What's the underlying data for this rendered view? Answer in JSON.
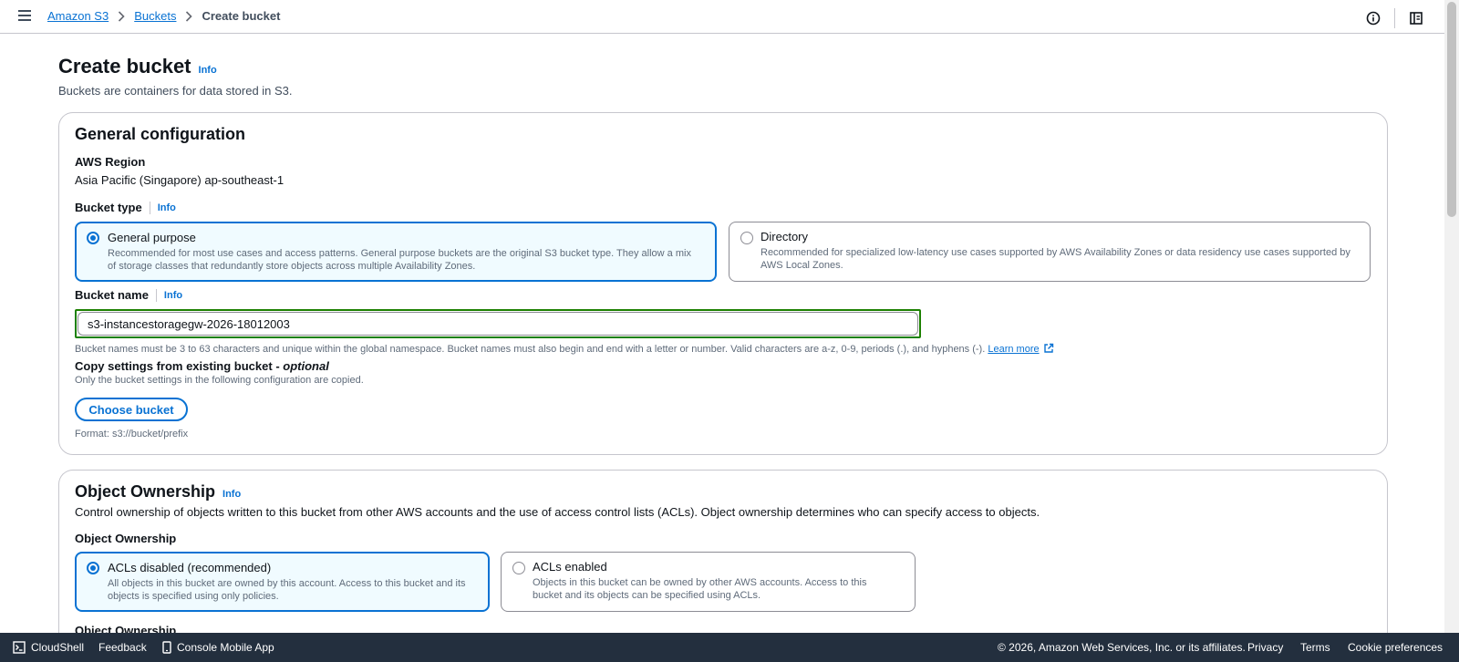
{
  "breadcrumb": {
    "items": [
      "Amazon S3",
      "Buckets"
    ],
    "current": "Create bucket"
  },
  "icons": {
    "menu": "hamburger-menu-icon",
    "info": "info-circle-icon",
    "panel": "notifications-panel-icon",
    "external": "external-link-icon",
    "cloudshell": "terminal-icon",
    "mobile": "mobile-device-icon"
  },
  "page": {
    "title": "Create bucket",
    "info": "Info",
    "description": "Buckets are containers for data stored in S3."
  },
  "general": {
    "heading": "General configuration",
    "region_label": "AWS Region",
    "region_value": "Asia Pacific (Singapore) ap-southeast-1",
    "bucket_type_label": "Bucket type",
    "bucket_type_info": "Info",
    "options": [
      {
        "title": "General purpose",
        "desc": "Recommended for most use cases and access patterns. General purpose buckets are the original S3 bucket type. They allow a mix of storage classes that redundantly store objects across multiple Availability Zones."
      },
      {
        "title": "Directory",
        "desc": "Recommended for specialized low-latency use cases supported by AWS Availability Zones or data residency use cases supported by AWS Local Zones."
      }
    ],
    "bucket_name_label": "Bucket name",
    "bucket_name_info": "Info",
    "bucket_name_value": "s3-instancestoragegw-2026-18012003",
    "bucket_name_hint": "Bucket names must be 3 to 63 characters and unique within the global namespace. Bucket names must also begin and end with a letter or number. Valid characters are a-z, 0-9, periods (.), and hyphens (-).",
    "learn_more": "Learn more",
    "copy_label": "Copy settings from existing bucket -",
    "copy_optional": "optional",
    "copy_desc": "Only the bucket settings in the following configuration are copied.",
    "choose_button": "Choose bucket",
    "format_hint": "Format: s3://bucket/prefix"
  },
  "ownership": {
    "heading": "Object Ownership",
    "info": "Info",
    "description": "Control ownership of objects written to this bucket from other AWS accounts and the use of access control lists (ACLs). Object ownership determines who can specify access to objects.",
    "label": "Object Ownership",
    "options": [
      {
        "title": "ACLs disabled (recommended)",
        "desc": "All objects in this bucket are owned by this account. Access to this bucket and its objects is specified using only policies."
      },
      {
        "title": "ACLs enabled",
        "desc": "Objects in this bucket can be owned by other AWS accounts. Access to this bucket and its objects can be specified using ACLs."
      }
    ],
    "cut_label": "Object Ownership"
  },
  "footer": {
    "cloudshell": "CloudShell",
    "feedback": "Feedback",
    "mobile_app": "Console Mobile App",
    "copyright": "© 2026, Amazon Web Services, Inc. or its affiliates.",
    "privacy": "Privacy",
    "terms": "Terms",
    "cookies": "Cookie preferences"
  },
  "colors": {
    "link": "#0972d3",
    "selected_border": "#0972d3",
    "focus_outline": "#1d8102",
    "footer_bg": "#232f3e"
  }
}
